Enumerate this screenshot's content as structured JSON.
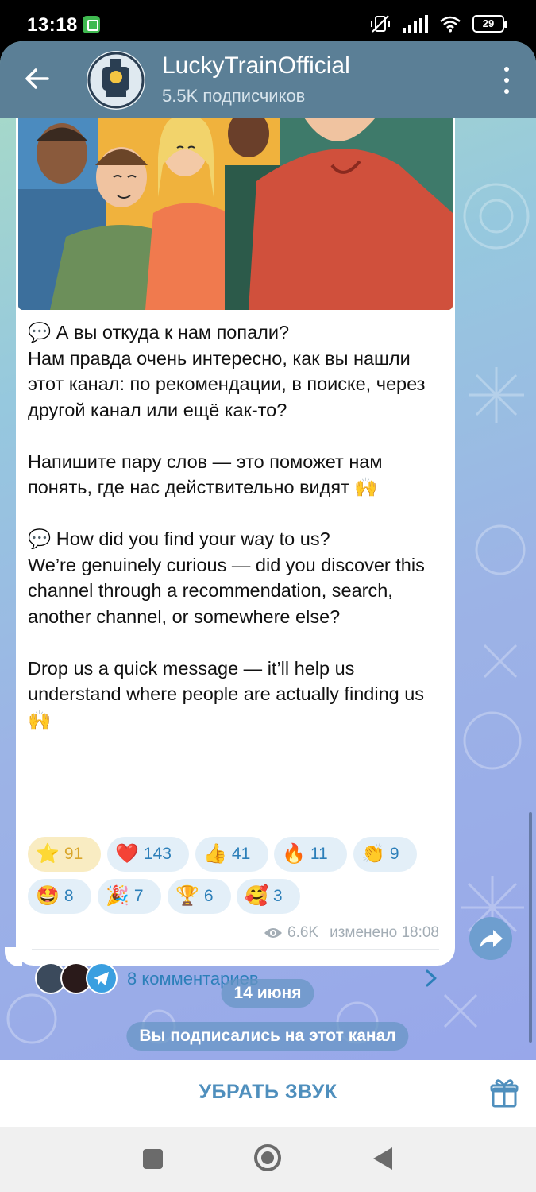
{
  "status_bar": {
    "time": "13:18",
    "battery": "29"
  },
  "header": {
    "channel_name": "LuckyTrainOfficial",
    "subscribers": "5.5K подписчиков"
  },
  "message": {
    "text": "💬 А вы откуда к нам попали?\nНам правда очень интересно, как вы нашли этот канал: по рекомендации, в поиске, через другой канал или ещё как-то?\n\nНапишите пару слов — это поможет нам понять, где нас действительно видят 🙌\n\n💬 How did you find your way to us?\nWe’re genuinely curious — did you discover this channel through a recommendation, search, another channel, or somewhere else?\n\nDrop us a quick message — it’ll help us understand where people are actually finding us 🙌",
    "reactions": [
      {
        "emoji": "⭐",
        "count": "91"
      },
      {
        "emoji": "❤️",
        "count": "143"
      },
      {
        "emoji": "👍",
        "count": "41"
      },
      {
        "emoji": "🔥",
        "count": "11"
      },
      {
        "emoji": "👏",
        "count": "9"
      },
      {
        "emoji": "🤩",
        "count": "8"
      },
      {
        "emoji": "🎉",
        "count": "7"
      },
      {
        "emoji": "🏆",
        "count": "6"
      },
      {
        "emoji": "🥰",
        "count": "3"
      }
    ],
    "views": "6.6K",
    "edited": "изменено 18:08",
    "comments_label": "8 комментариев"
  },
  "service": {
    "date": "14 июня",
    "subscribed": "Вы подписались на этот канал"
  },
  "bottom": {
    "mute_label": "УБРАТЬ ЗВУК"
  },
  "colors": {
    "header": "#5b7f96",
    "accent": "#2c7fb9",
    "star_reaction_bg": "#f9ecc2"
  }
}
